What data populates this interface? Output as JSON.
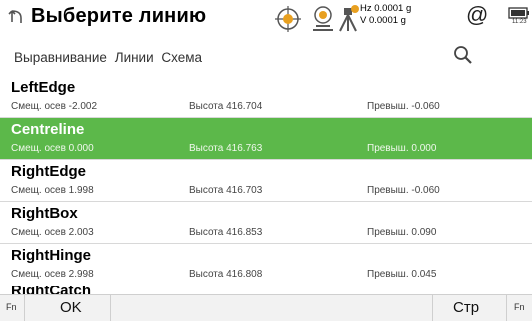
{
  "header": {
    "title": "Выберите линию",
    "back_icon": "back-arrow-icon",
    "hz": "Hz 0.0001 g",
    "v": "V  0.0001 g",
    "at_symbol": "@",
    "battery_time": "11:23"
  },
  "tabs": [
    {
      "label": "Выравнивание",
      "active": true
    },
    {
      "label": "Линии",
      "active": false
    },
    {
      "label": "Схема",
      "active": false
    }
  ],
  "rows": [
    {
      "name": "LeftEdge",
      "offset": "Смещ. осев  -2.002",
      "height": "Высота  416.704",
      "diff": "Превыш.  -0.060",
      "selected": false
    },
    {
      "name": "Centreline",
      "offset": "Смещ. осев  0.000",
      "height": "Высота  416.763",
      "diff": "Превыш.  0.000",
      "selected": true
    },
    {
      "name": "RightEdge",
      "offset": "Смещ. осев  1.998",
      "height": "Высота  416.703",
      "diff": "Превыш.  -0.060",
      "selected": false
    },
    {
      "name": "RightBox",
      "offset": "Смещ. осев  2.003",
      "height": "Высота  416.853",
      "diff": "Превыш.  0.090",
      "selected": false
    },
    {
      "name": "RightHinge",
      "offset": "Смещ. осев  2.998",
      "height": "Высота  416.808",
      "diff": "Превыш.  0.045",
      "selected": false
    }
  ],
  "partial_row": "RightCatch",
  "bottom": {
    "fn_left": "Fn",
    "ok": "OK",
    "page": "Стр",
    "fn_right": "Fn"
  },
  "colors": {
    "selected_row": "#5cb84a"
  }
}
